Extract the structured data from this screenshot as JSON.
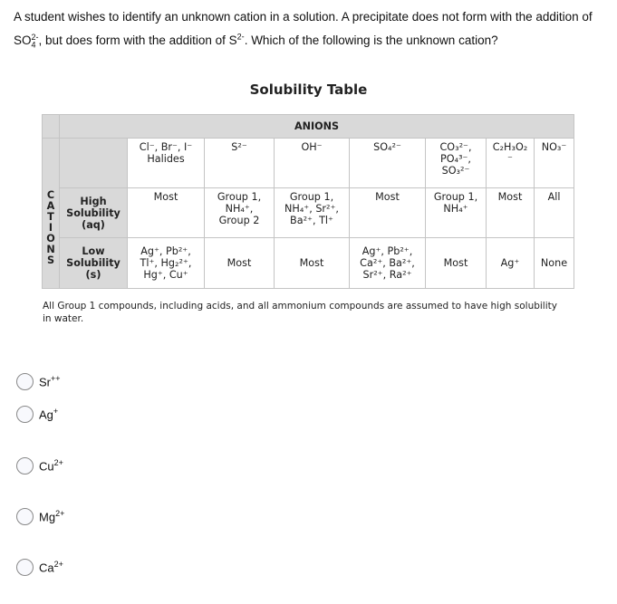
{
  "question": {
    "line1": "A student wishes to identify an unknown cation in a solution. A precipitate does not form with the addition of",
    "part_a": "SO",
    "sub_a": "4",
    "sup_a": "2-",
    "part_b": ", but does form with the addition of S",
    "sup_b": "2-",
    "part_c": ". Which of the following is the unknown cation?"
  },
  "solubility_table": {
    "title": "Solubility Table",
    "anions_header": "ANIONS",
    "cations_letters": [
      "C",
      "A",
      "T",
      "I",
      "O",
      "N",
      "S"
    ],
    "anion_columns": [
      {
        "line1": "Cl⁻, Br⁻, I⁻",
        "line2": "Halides"
      },
      {
        "line1": "S²⁻"
      },
      {
        "line1": "OH⁻"
      },
      {
        "line1": "SO₄²⁻"
      },
      {
        "line1": "CO₃²⁻,",
        "line2": "PO₄³⁻,",
        "line3": "SO₃²⁻"
      },
      {
        "line1": "C₂H₃O₂",
        "line2": "⁻"
      },
      {
        "line1": "NO₃⁻"
      }
    ],
    "rows": [
      {
        "label": [
          "High",
          "Solubility",
          "(aq)"
        ],
        "cells": [
          [
            "Most"
          ],
          [
            "Group 1,",
            "NH₄⁺,",
            "Group 2"
          ],
          [
            "Group 1,",
            "NH₄⁺, Sr²⁺,",
            "Ba²⁺, Tl⁺"
          ],
          [
            "Most"
          ],
          [
            "Group 1,",
            "NH₄⁺"
          ],
          [
            "Most"
          ],
          [
            "All"
          ]
        ]
      },
      {
        "label": [
          "Low",
          "Solubility",
          "(s)"
        ],
        "cells": [
          [
            "Ag⁺, Pb²⁺,",
            "Tl⁺, Hg₂²⁺,",
            "Hg⁺, Cu⁺"
          ],
          [
            "Most"
          ],
          [
            "Most"
          ],
          [
            "Ag⁺, Pb²⁺,",
            "Ca²⁺, Ba²⁺,",
            "Sr²⁺, Ra²⁺"
          ],
          [
            "Most"
          ],
          [
            "Ag⁺"
          ],
          [
            "None"
          ]
        ]
      }
    ],
    "note": "All Group 1 compounds, including acids, and all ammonium compounds are assumed to have high solubility in water."
  },
  "options": [
    {
      "base": "Sr",
      "charge": "++",
      "selected": false
    },
    {
      "base": "Ag",
      "charge": "+",
      "selected": false
    },
    {
      "base": "Cu",
      "charge": "2+",
      "selected": false
    },
    {
      "base": "Mg",
      "charge": "2+",
      "selected": false
    },
    {
      "base": "Ca",
      "charge": "2+",
      "selected": false
    }
  ]
}
